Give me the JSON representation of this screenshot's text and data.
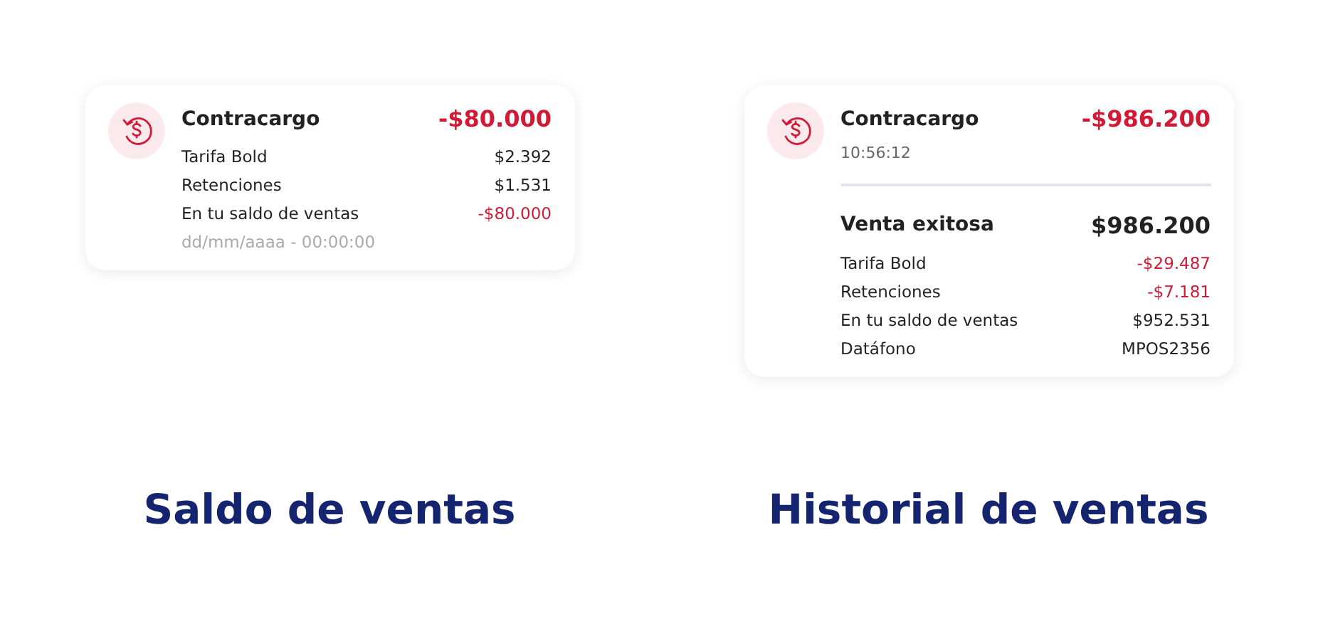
{
  "panels": [
    {
      "caption": "Saldo de ventas",
      "sections": [
        {
          "title": "Contracargo",
          "amount": "-$80.000",
          "negative": true,
          "rows": [
            {
              "label": "Tarifa Bold",
              "value": "$2.392",
              "negative": false
            },
            {
              "label": "Retenciones",
              "value": "$1.531",
              "negative": false
            },
            {
              "label": "En tu saldo de ventas",
              "value": "-$80.000",
              "negative": true
            }
          ],
          "footnote": "dd/mm/aaaa - 00:00:00"
        }
      ]
    },
    {
      "caption": "Historial de ventas",
      "sections": [
        {
          "title": "Contracargo",
          "amount": "-$986.200",
          "negative": true,
          "subtitle": "10:56:12"
        },
        {
          "title": "Venta exitosa",
          "amount": "$986.200",
          "negative": false,
          "rows": [
            {
              "label": "Tarifa Bold",
              "value": "-$29.487",
              "negative": true
            },
            {
              "label": "Retenciones",
              "value": "-$7.181",
              "negative": true
            },
            {
              "label": "En tu saldo de ventas",
              "value": "$952.531",
              "negative": false
            },
            {
              "label": "Datáfono",
              "value": "MPOS2356",
              "negative": false
            }
          ]
        }
      ]
    }
  ]
}
